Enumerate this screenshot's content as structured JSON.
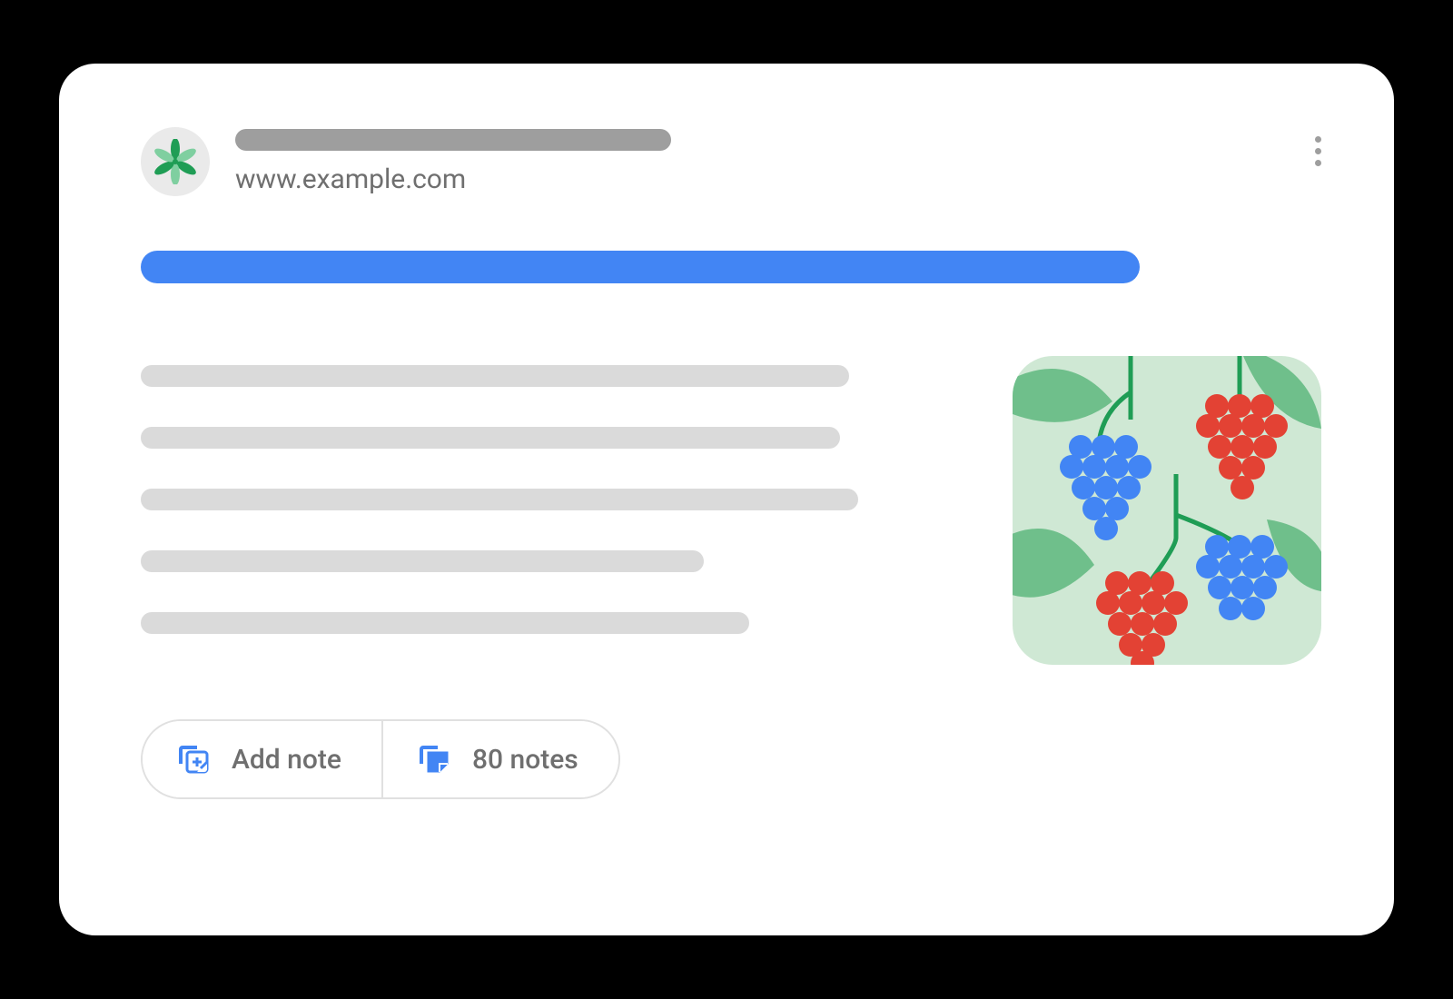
{
  "header": {
    "site_url": "www.example.com"
  },
  "actions": {
    "add_note_label": "Add note",
    "notes_count_label": "80 notes"
  },
  "colors": {
    "accent": "#4285f4",
    "placeholder_dark": "#9e9e9e",
    "placeholder_light": "#dadada"
  }
}
